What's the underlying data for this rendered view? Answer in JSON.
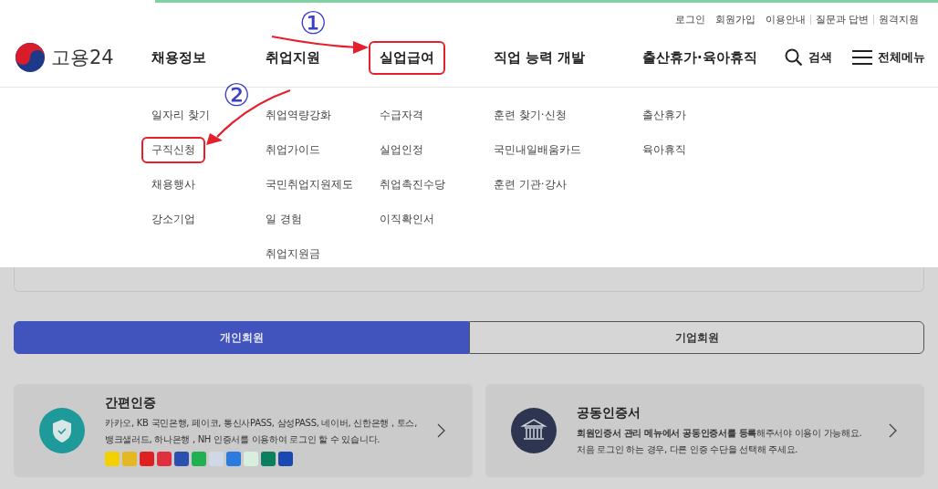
{
  "top_links": [
    {
      "label": "로그인",
      "separated": false
    },
    {
      "label": "회원가입",
      "separated": false
    },
    {
      "label": "이용안내",
      "separated": false
    },
    {
      "label": "질문과 답변",
      "separated": true
    },
    {
      "label": "원격지원",
      "separated": true
    }
  ],
  "logo": {
    "text": "고용24"
  },
  "nav": [
    {
      "label": "채용정보",
      "marked": false,
      "items": [
        {
          "label": "일자리 찾기",
          "marked": false
        },
        {
          "label": "구직신청",
          "marked": true
        },
        {
          "label": "채용행사",
          "marked": false
        },
        {
          "label": "강소기업",
          "marked": false
        }
      ]
    },
    {
      "label": "취업지원",
      "marked": false,
      "items": [
        {
          "label": "취업역량강화",
          "marked": false
        },
        {
          "label": "취업가이드",
          "marked": false
        },
        {
          "label": "국민취업지원제도",
          "marked": false
        },
        {
          "label": "일 경험",
          "marked": false
        },
        {
          "label": "취업지원금",
          "marked": false
        }
      ]
    },
    {
      "label": "실업급여",
      "marked": true,
      "items": [
        {
          "label": "수급자격",
          "marked": false
        },
        {
          "label": "실업인정",
          "marked": false
        },
        {
          "label": "취업촉진수당",
          "marked": false
        },
        {
          "label": "이직확인서",
          "marked": false
        }
      ]
    },
    {
      "label": "직업 능력 개발",
      "marked": false,
      "items": [
        {
          "label": "훈련 찾기·신청",
          "marked": false
        },
        {
          "label": "국민내일배움카드",
          "marked": false
        },
        {
          "label": "훈련 기관·강사",
          "marked": false
        }
      ]
    },
    {
      "label": "출산휴가·육아휴직",
      "marked": false,
      "items": [
        {
          "label": "출산휴가",
          "marked": false
        },
        {
          "label": "육아휴직",
          "marked": false
        }
      ]
    }
  ],
  "search": {
    "label": "검색"
  },
  "all_menu": {
    "label": "전체메뉴"
  },
  "annotations": [
    {
      "text": "①"
    },
    {
      "text": "②"
    }
  ],
  "member_tabs": [
    {
      "label": "개인회원",
      "selected": true
    },
    {
      "label": "기업회원",
      "selected": false
    }
  ],
  "cards": [
    {
      "kind": "simple",
      "title": "간편인증",
      "lines": [
        "카카오, KB 국민은행, 페이코, 통신사PASS, 삼성PASS, 네이버, 신한은행 , 토스,",
        "뱅크샐러드, 하나은행 , NH 인증서를 이용하여 로그인 할 수 있습니다."
      ]
    },
    {
      "kind": "certificate",
      "title": "공동인증서",
      "lines": [
        "**회원인증서 관리 메뉴에서 공동인증서를 등록**해주서야 이용이 가능해요.",
        "처음 로그인 하는 경우, 다른 인증 수단을 선택해 주세요."
      ]
    }
  ]
}
